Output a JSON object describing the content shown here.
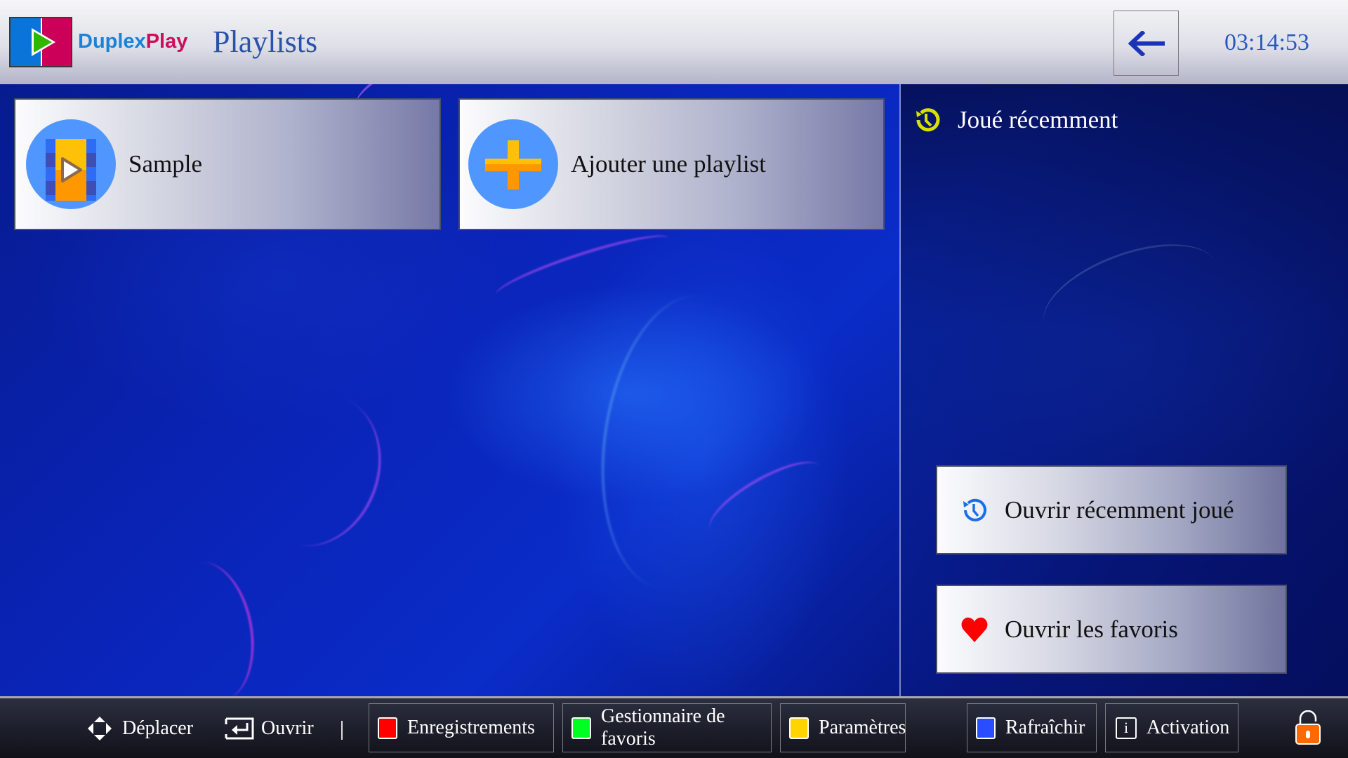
{
  "header": {
    "brand_part1": "Duplex",
    "brand_part2": "Play",
    "title": "Playlists",
    "back_icon": "arrow-left-icon",
    "clock": "03:14:53"
  },
  "playlists": [
    {
      "label": "Sample",
      "icon": "video-playlist-icon"
    },
    {
      "label": "Ajouter une playlist",
      "icon": "plus-icon"
    }
  ],
  "recent": {
    "title": "Joué récemment",
    "icon": "history-icon",
    "accent": "#d8e000"
  },
  "side_buttons": [
    {
      "label": "Ouvrir récemment joué",
      "icon": "history-icon",
      "color": "#1a6fe8"
    },
    {
      "label": "Ouvrir les favoris",
      "icon": "heart-icon",
      "color": "#ff0000"
    }
  ],
  "bottom_bar": {
    "hints": [
      {
        "label": "Déplacer",
        "icon": "dpad-icon"
      },
      {
        "label": "Ouvrir",
        "icon": "enter-icon"
      }
    ],
    "separator": "|",
    "buttons": [
      {
        "label": "Enregistrements",
        "color": "#ff0000",
        "icon": "red-key-icon"
      },
      {
        "label": "Gestionnaire de favoris",
        "color": "#00ff20",
        "icon": "green-key-icon"
      },
      {
        "label": "Paramètres",
        "color": "#ffd400",
        "icon": "yellow-key-icon"
      },
      {
        "label": "Rafraîchir",
        "color": "#2a4dff",
        "icon": "blue-key-icon"
      },
      {
        "label": "Activation",
        "info_glyph": "i",
        "icon": "info-icon"
      }
    ],
    "lock_icon": "unlocked-padlock-icon",
    "lock_color": "#ff6a00"
  }
}
